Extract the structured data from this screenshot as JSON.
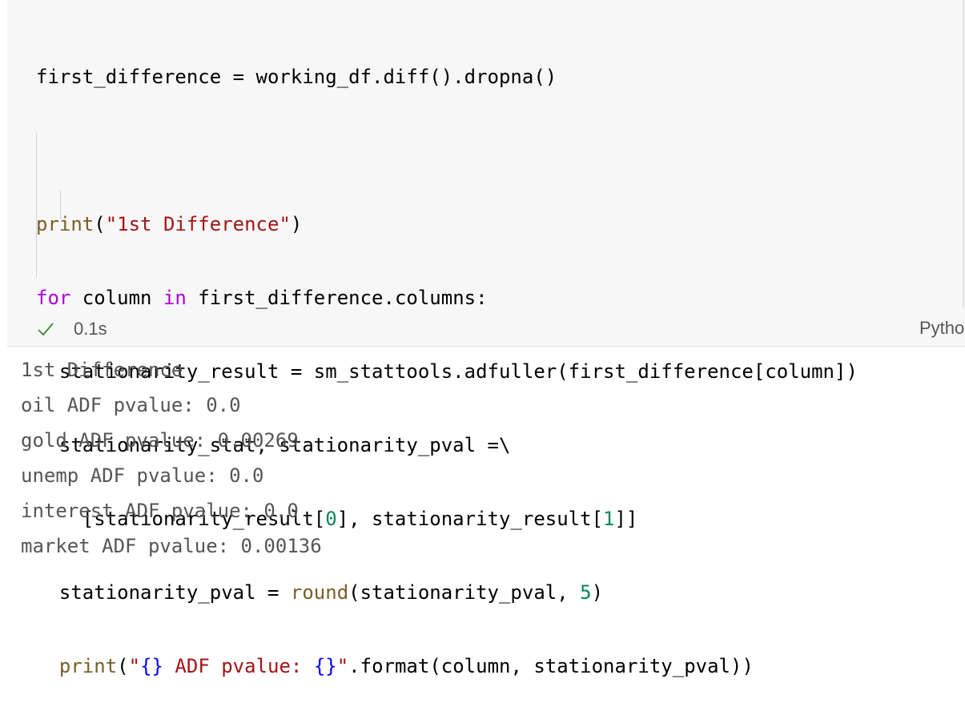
{
  "code_lines": {
    "l1": {
      "a": "first_difference = working_df.diff().dropna()"
    },
    "l2": {
      "a": ""
    },
    "l3": {
      "fn": "print",
      "p1": "(",
      "str": "\"1st Difference\"",
      "p2": ")"
    },
    "l4": {
      "kw1": "for",
      "a": " column ",
      "kw2": "in",
      "b": " first_difference.columns:"
    },
    "l5": {
      "a": "  stationarity_result = sm_stattools.adfuller(first_difference[column])"
    },
    "l6": {
      "a": "  stationarity_stat, stationarity_pval =\\"
    },
    "l7": {
      "a": "    [stationarity_result[",
      "n1": "0",
      "b": "], stationarity_result[",
      "n2": "1",
      "c": "]]"
    },
    "l8": {
      "a": "  stationarity_pval = ",
      "fn": "round",
      "b": "(stationarity_pval, ",
      "n": "5",
      "c": ")"
    },
    "l9": {
      "a": "  ",
      "fn": "print",
      "p1": "(",
      "q1": "\"",
      "b1": "{}",
      "s": " ADF pvalue: ",
      "b2": "{}",
      "q2": "\"",
      "c": ".format(column, stationarity_pval))"
    }
  },
  "status": {
    "icon": "check-icon",
    "check_color": "#388a34",
    "duration": "0.1s",
    "language": "Python"
  },
  "output_lines": [
    "1st Difference",
    "oil ADF pvalue: 0.0",
    "gold ADF pvalue: 0.00269",
    "unemp ADF pvalue: 0.0",
    "interest ADF pvalue: 0.0",
    "market ADF pvalue: 0.00136"
  ]
}
